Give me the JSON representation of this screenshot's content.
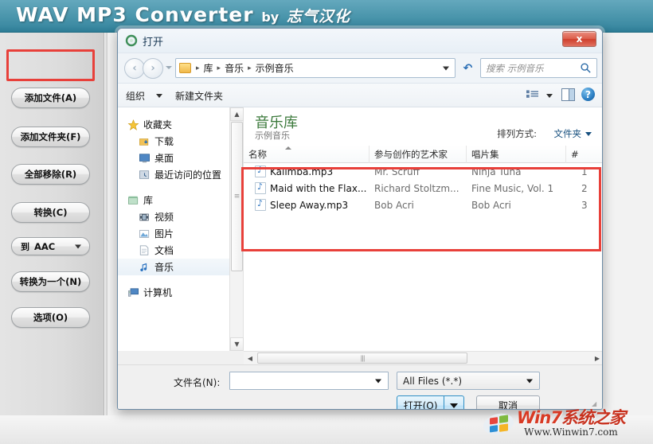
{
  "app": {
    "title_main": "WAV MP3 Converter",
    "title_by": "by",
    "title_cn": "志气汉化",
    "header_color": "#4e98ae",
    "buttons": [
      {
        "label": "添加文件(A)",
        "name": "add-file"
      },
      {
        "label": "添加文件夹(F)",
        "name": "add-folder"
      },
      {
        "label": "全部移除(R)",
        "name": "remove-all"
      },
      {
        "label": "转换(C)",
        "name": "convert"
      },
      {
        "label": "转换为一个(N)",
        "name": "convert-to-one"
      },
      {
        "label": "选项(O)",
        "name": "options"
      }
    ],
    "format_select": {
      "prefix": "到",
      "value": "AAC"
    },
    "highlight_color": "#e8403a"
  },
  "dialog": {
    "title": "打开",
    "close_label": "x",
    "address": {
      "crumbs": [
        "库",
        "音乐",
        "示例音乐"
      ],
      "separator": "▸"
    },
    "search": {
      "placeholder": "搜索 示例音乐"
    },
    "commandbar": {
      "organize": "组织",
      "new_folder": "新建文件夹"
    },
    "navpane": [
      {
        "label": "收藏夹",
        "level": 1,
        "icon": "star-icon",
        "selected": false
      },
      {
        "label": "下载",
        "level": 2,
        "icon": "downloads-icon",
        "selected": false
      },
      {
        "label": "桌面",
        "level": 2,
        "icon": "desktop-icon",
        "selected": false
      },
      {
        "label": "最近访问的位置",
        "level": 2,
        "icon": "recent-places-icon",
        "selected": false
      },
      {
        "label": "库",
        "level": 1,
        "icon": "library-icon",
        "selected": false
      },
      {
        "label": "视频",
        "level": 2,
        "icon": "video-icon",
        "selected": false
      },
      {
        "label": "图片",
        "level": 2,
        "icon": "pictures-icon",
        "selected": false
      },
      {
        "label": "文档",
        "level": 2,
        "icon": "documents-icon",
        "selected": false
      },
      {
        "label": "音乐",
        "level": 2,
        "icon": "music-icon",
        "selected": true
      },
      {
        "label": "计算机",
        "level": 1,
        "icon": "computer-icon",
        "selected": false
      }
    ],
    "library": {
      "title": "音乐库",
      "subtitle": "示例音乐",
      "arrange_label": "排列方式:",
      "arrange_value": "文件夹"
    },
    "columns": [
      "名称",
      "参与创作的艺术家",
      "唱片集",
      "#"
    ],
    "files": [
      {
        "name": "Kalimba.mp3",
        "artist": "Mr. Scruff",
        "album": "Ninja Tuna",
        "num": "1"
      },
      {
        "name": "Maid with the Flax...",
        "artist": "Richard Stoltzm...",
        "album": "Fine Music, Vol. 1",
        "num": "2"
      },
      {
        "name": "Sleep Away.mp3",
        "artist": "Bob Acri",
        "album": "Bob Acri",
        "num": "3"
      }
    ],
    "footer": {
      "filename_label": "文件名(N):",
      "filename_value": "",
      "filetype_value": "All Files (*.*)",
      "open_label": "打开(O)",
      "cancel_label": "取消"
    }
  },
  "watermark": {
    "win": "Win",
    "seven": "7",
    "cn": "系统之家",
    "url": "Www.Winwin7.com"
  }
}
